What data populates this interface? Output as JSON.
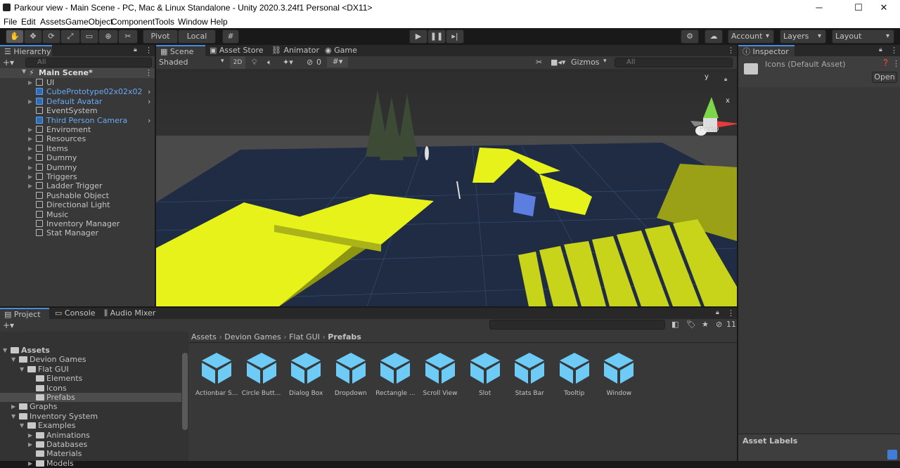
{
  "window": {
    "title": "Parkour view - Main Scene - PC, Mac & Linux Standalone - Unity 2020.3.24f1 Personal <DX11>"
  },
  "menu": [
    "File",
    "Edit",
    "Assets",
    "GameObject",
    "Component",
    "Tools",
    "Window",
    "Help"
  ],
  "toolbar": {
    "pivot": "Pivot",
    "local": "Local",
    "account": "Account",
    "layers": "Layers",
    "layout": "Layout"
  },
  "hierarchy": {
    "tab": "Hierarchy",
    "search_placeholder": "All",
    "scene": "Main Scene*",
    "items": [
      {
        "label": "UI",
        "prefab": false,
        "arrow": true,
        "chev": false
      },
      {
        "label": "CubePrototype02x02x02",
        "prefab": true,
        "arrow": false,
        "chev": true
      },
      {
        "label": "Default Avatar",
        "prefab": true,
        "arrow": true,
        "chev": true
      },
      {
        "label": "EventSystem",
        "prefab": false,
        "arrow": false,
        "chev": false
      },
      {
        "label": "Third Person Camera",
        "prefab": true,
        "arrow": false,
        "chev": true
      },
      {
        "label": "Enviroment",
        "prefab": false,
        "arrow": true,
        "chev": false
      },
      {
        "label": "Resources",
        "prefab": false,
        "arrow": true,
        "chev": false
      },
      {
        "label": "Items",
        "prefab": false,
        "arrow": true,
        "chev": false
      },
      {
        "label": "Dummy",
        "prefab": false,
        "arrow": true,
        "chev": false
      },
      {
        "label": "Dummy",
        "prefab": false,
        "arrow": true,
        "chev": false
      },
      {
        "label": "Triggers",
        "prefab": false,
        "arrow": true,
        "chev": false
      },
      {
        "label": "Ladder Trigger",
        "prefab": false,
        "arrow": true,
        "chev": false
      },
      {
        "label": "Pushable Object",
        "prefab": false,
        "arrow": false,
        "chev": false
      },
      {
        "label": "Directional Light",
        "prefab": false,
        "arrow": false,
        "chev": false
      },
      {
        "label": "Music",
        "prefab": false,
        "arrow": false,
        "chev": false
      },
      {
        "label": "Inventory Manager",
        "prefab": false,
        "arrow": false,
        "chev": false
      },
      {
        "label": "Stat Manager",
        "prefab": false,
        "arrow": false,
        "chev": false
      }
    ]
  },
  "scene_view": {
    "tabs": [
      "Scene",
      "Asset Store",
      "Animator",
      "Game"
    ],
    "shading": "Shaded",
    "mode_2d": "2D",
    "hidden_count": "0",
    "gizmos": "Gizmos",
    "search_placeholder": "All",
    "persp": "Persp",
    "axis_y": "y",
    "axis_x": "x"
  },
  "inspector": {
    "tab": "Inspector",
    "asset": "Icons (Default Asset)",
    "open": "Open",
    "labels": "Asset Labels"
  },
  "project": {
    "tabs": [
      "Project",
      "Console",
      "Audio Mixer"
    ],
    "count": "11",
    "tree": [
      {
        "label": "Assets",
        "depth": 0,
        "open": true,
        "bold": true
      },
      {
        "label": "Devion Games",
        "depth": 1,
        "open": true
      },
      {
        "label": "Flat GUI",
        "depth": 2,
        "open": true
      },
      {
        "label": "Elements",
        "depth": 3,
        "open": false,
        "leaf": true
      },
      {
        "label": "Icons",
        "depth": 3,
        "open": false,
        "leaf": true
      },
      {
        "label": "Prefabs",
        "depth": 3,
        "open": false,
        "leaf": true,
        "selected": true
      },
      {
        "label": "Graphs",
        "depth": 1,
        "open": false
      },
      {
        "label": "Inventory System",
        "depth": 1,
        "open": true
      },
      {
        "label": "Examples",
        "depth": 2,
        "open": true
      },
      {
        "label": "Animations",
        "depth": 3,
        "open": false
      },
      {
        "label": "Databases",
        "depth": 3,
        "open": false
      },
      {
        "label": "Materials",
        "depth": 3,
        "open": false,
        "leaf": true
      },
      {
        "label": "Models",
        "depth": 3,
        "open": false
      }
    ],
    "breadcrumb": [
      "Assets",
      "Devion Games",
      "Flat GUI",
      "Prefabs"
    ],
    "prefabs": [
      "Actionbar S...",
      "Circle Butt...",
      "Dialog Box",
      "Dropdown",
      "Rectangle ...",
      "Scroll View",
      "Slot",
      "Stats Bar",
      "Tooltip",
      "Window"
    ]
  },
  "colors": {
    "accent": "#4a8be0",
    "prefab_blue": "#6ecbf5",
    "platform_yellow": "#e6f21a"
  }
}
